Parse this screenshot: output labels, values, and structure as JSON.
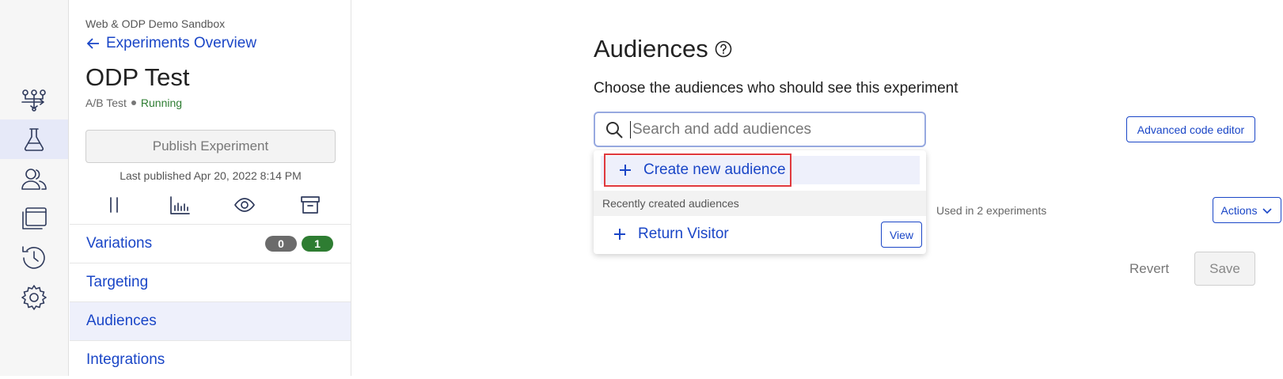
{
  "sidebar": {
    "project": "Web & ODP Demo Sandbox",
    "back_link": "Experiments Overview",
    "experiment_title": "ODP Test",
    "experiment_type": "A/B Test",
    "experiment_status": "Running",
    "publish_label": "Publish Experiment",
    "last_published": "Last published Apr 20, 2022 8:14 PM",
    "nav": [
      {
        "label": "Variations",
        "badges": [
          "0",
          "1"
        ]
      },
      {
        "label": "Targeting"
      },
      {
        "label": "Audiences",
        "active": true
      },
      {
        "label": "Integrations"
      }
    ]
  },
  "rail": {
    "icons": [
      "flow-icon",
      "flask-icon",
      "users-icon",
      "windows-icon",
      "history-icon",
      "gear-icon"
    ],
    "active": "flask-icon"
  },
  "main": {
    "title": "Audiences",
    "subtitle": "Choose the audiences who should see this experiment",
    "search_placeholder": "Search and add audiences",
    "advanced_label": "Advanced code editor",
    "dropdown": {
      "create_label": "Create new audience",
      "recent_heading": "Recently created audiences",
      "recent_items": [
        {
          "label": "Return Visitor",
          "view_label": "View"
        }
      ]
    },
    "usage_text": "Used in 2 experiments",
    "actions_label": "Actions",
    "revert_label": "Revert",
    "save_label": "Save"
  },
  "colors": {
    "accent": "#1a46c7",
    "running": "#2e7d32",
    "highlight": "#e0393e"
  }
}
